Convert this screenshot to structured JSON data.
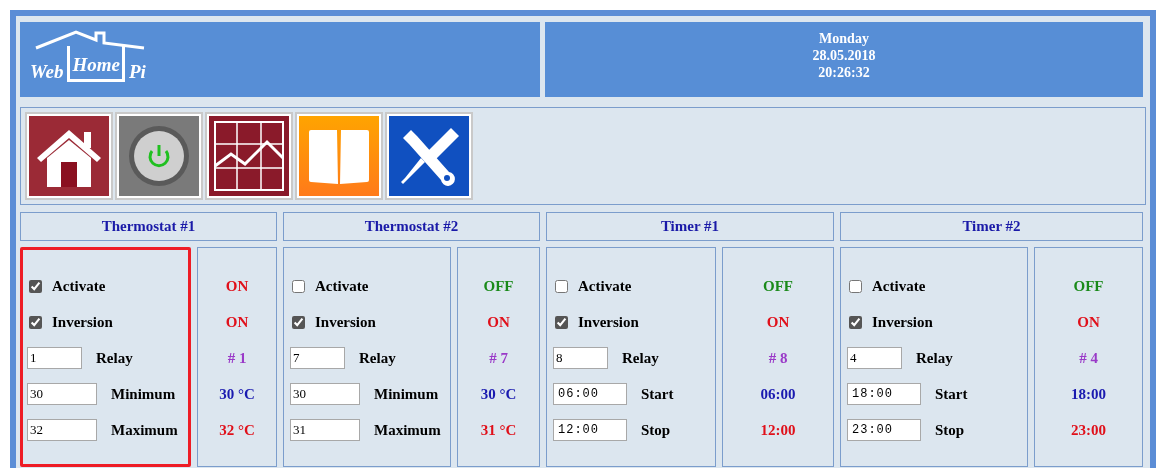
{
  "logo": {
    "words": [
      "Web",
      "Home",
      "Pi"
    ]
  },
  "datetime": {
    "day": "Monday",
    "date": "28.05.2018",
    "time": "20:26:32"
  },
  "nav": [
    {
      "kind": "home"
    },
    {
      "kind": "power"
    },
    {
      "kind": "chart"
    },
    {
      "kind": "book"
    },
    {
      "kind": "tools"
    }
  ],
  "panels": [
    {
      "title": "Thermostat #1",
      "highlighted": true,
      "rows": [
        {
          "kind": "checkbox",
          "label": "Activate",
          "checked": true,
          "status": "ON",
          "color": "#e0101a"
        },
        {
          "kind": "checkbox",
          "label": "Inversion",
          "checked": true,
          "status": "ON",
          "color": "#e0101a"
        },
        {
          "kind": "number",
          "label": "Relay",
          "value": "1",
          "status": "# 1",
          "color": "#9a3ac8"
        },
        {
          "kind": "number",
          "label": "Minimum",
          "value": "30",
          "status": "30 °C",
          "color": "#1a1ab0"
        },
        {
          "kind": "number",
          "label": "Maximum",
          "value": "32",
          "status": "32 °C",
          "color": "#e0101a"
        }
      ]
    },
    {
      "title": "Thermostat #2",
      "highlighted": false,
      "rows": [
        {
          "kind": "checkbox",
          "label": "Activate",
          "checked": false,
          "status": "OFF",
          "color": "#1a8a1a"
        },
        {
          "kind": "checkbox",
          "label": "Inversion",
          "checked": true,
          "status": "ON",
          "color": "#e0101a"
        },
        {
          "kind": "number",
          "label": "Relay",
          "value": "7",
          "status": "# 7",
          "color": "#9a3ac8"
        },
        {
          "kind": "number",
          "label": "Minimum",
          "value": "30",
          "status": "30 °C",
          "color": "#1a1ab0"
        },
        {
          "kind": "number",
          "label": "Maximum",
          "value": "31",
          "status": "31 °C",
          "color": "#e0101a"
        }
      ]
    },
    {
      "title": "Timer #1",
      "highlighted": false,
      "rows": [
        {
          "kind": "checkbox",
          "label": "Activate",
          "checked": false,
          "status": "OFF",
          "color": "#1a8a1a"
        },
        {
          "kind": "checkbox",
          "label": "Inversion",
          "checked": true,
          "status": "ON",
          "color": "#e0101a"
        },
        {
          "kind": "number",
          "label": "Relay",
          "value": "8",
          "status": "# 8",
          "color": "#9a3ac8"
        },
        {
          "kind": "time",
          "label": "Start",
          "value": "06:00",
          "status": "06:00",
          "color": "#1a1ab0"
        },
        {
          "kind": "time",
          "label": "Stop",
          "value": "12:00",
          "status": "12:00",
          "color": "#e0101a"
        }
      ]
    },
    {
      "title": "Timer #2",
      "highlighted": false,
      "rows": [
        {
          "kind": "checkbox",
          "label": "Activate",
          "checked": false,
          "status": "OFF",
          "color": "#1a8a1a"
        },
        {
          "kind": "checkbox",
          "label": "Inversion",
          "checked": true,
          "status": "ON",
          "color": "#e0101a"
        },
        {
          "kind": "number",
          "label": "Relay",
          "value": "4",
          "status": "# 4",
          "color": "#9a3ac8"
        },
        {
          "kind": "time",
          "label": "Start",
          "value": "18:00",
          "status": "18:00",
          "color": "#1a1ab0"
        },
        {
          "kind": "time",
          "label": "Stop",
          "value": "23:00",
          "status": "23:00",
          "color": "#e0101a"
        }
      ]
    }
  ]
}
